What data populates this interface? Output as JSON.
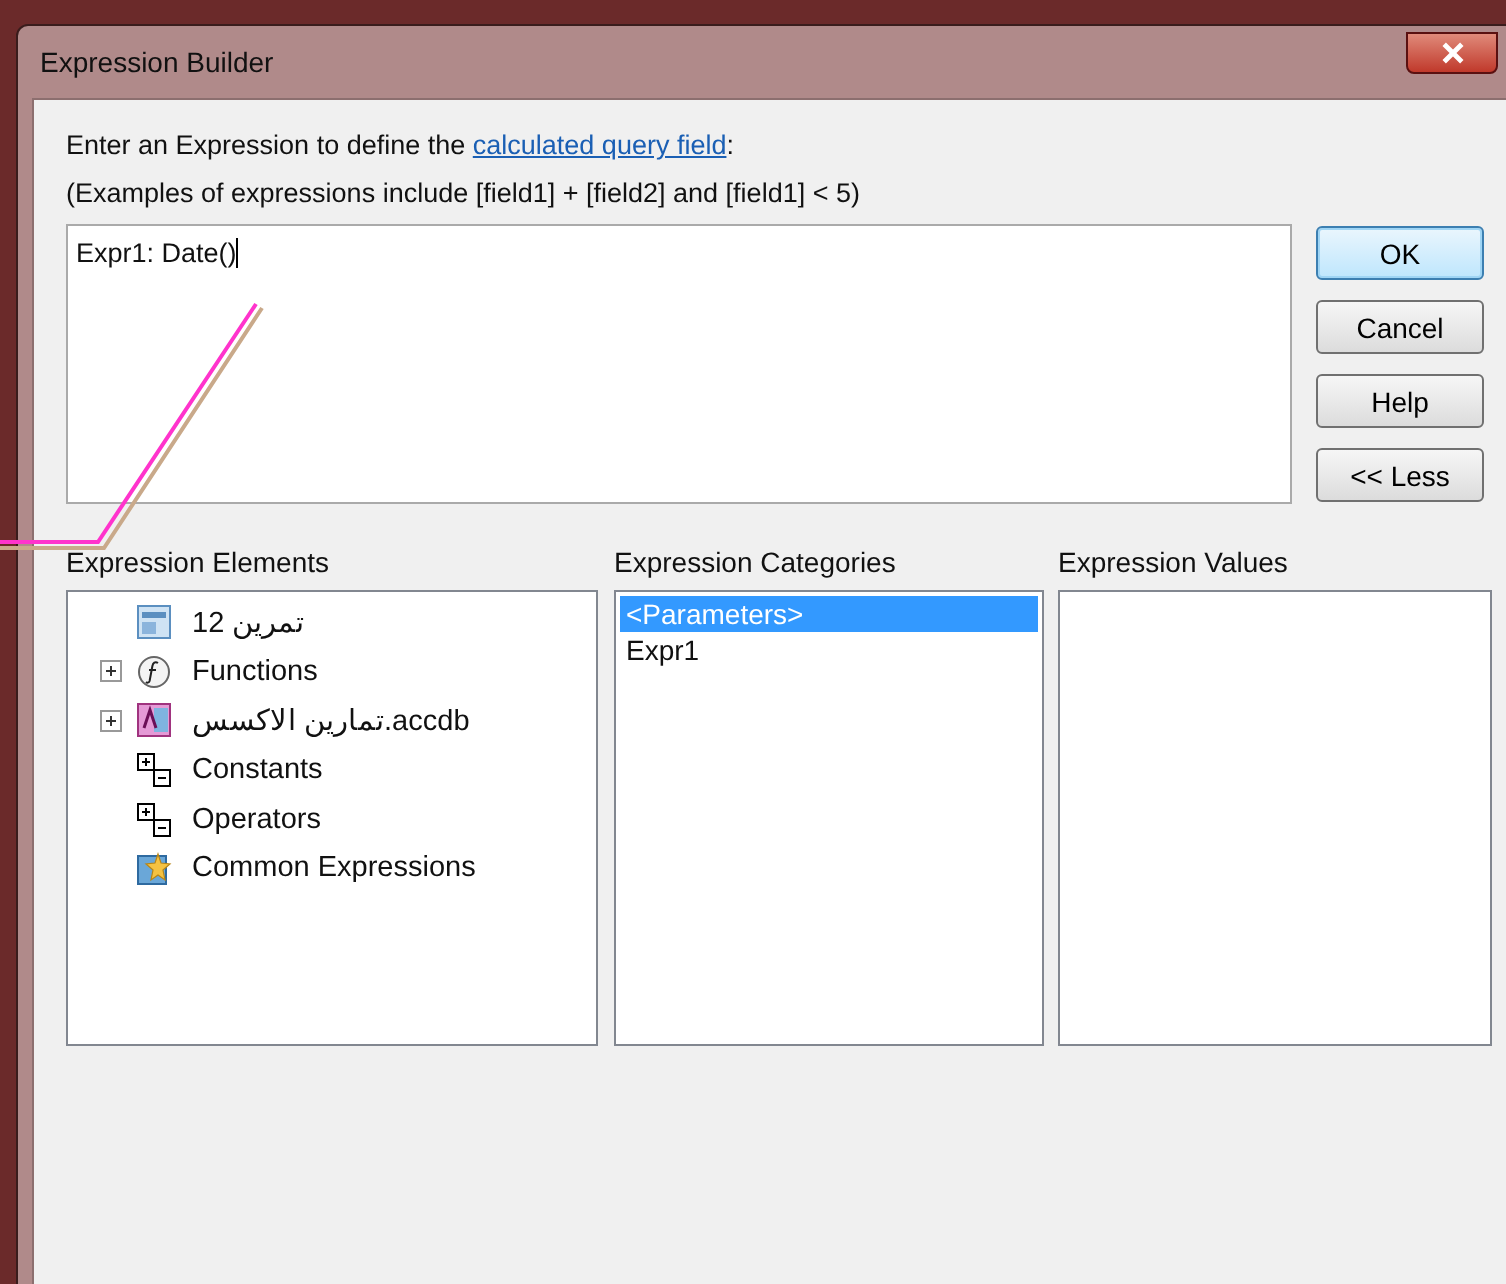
{
  "window": {
    "title": "Expression Builder"
  },
  "intro": {
    "before": "Enter an Expression to define the ",
    "link": "calculated query field",
    "after": ":"
  },
  "examples": "(Examples of expressions include [field1] + [field2] and [field1] < 5)",
  "expression": {
    "value": "Expr1: Date()"
  },
  "buttons": [
    {
      "label": "OK",
      "default": true
    },
    {
      "label": "Cancel",
      "default": false
    },
    {
      "label": "Help",
      "default": false
    },
    {
      "label": "<< Less",
      "default": false
    }
  ],
  "elements": {
    "label": "Expression Elements",
    "items": [
      {
        "label": "تمرين 12",
        "kind": "form"
      },
      {
        "label": "Functions",
        "kind": "function",
        "expanded": false
      },
      {
        "label": "تمارين الاكسس.accdb",
        "kind": "database",
        "expanded": false
      },
      {
        "label": "Constants",
        "kind": "constants"
      },
      {
        "label": "Operators",
        "kind": "operators"
      },
      {
        "label": "Common Expressions",
        "kind": "common"
      }
    ]
  },
  "categories": {
    "label": "Expression Categories",
    "items": [
      {
        "label": "<Parameters>",
        "selected": true
      },
      {
        "label": "Expr1",
        "selected": false
      }
    ]
  },
  "values": {
    "label": "Expression Values"
  }
}
